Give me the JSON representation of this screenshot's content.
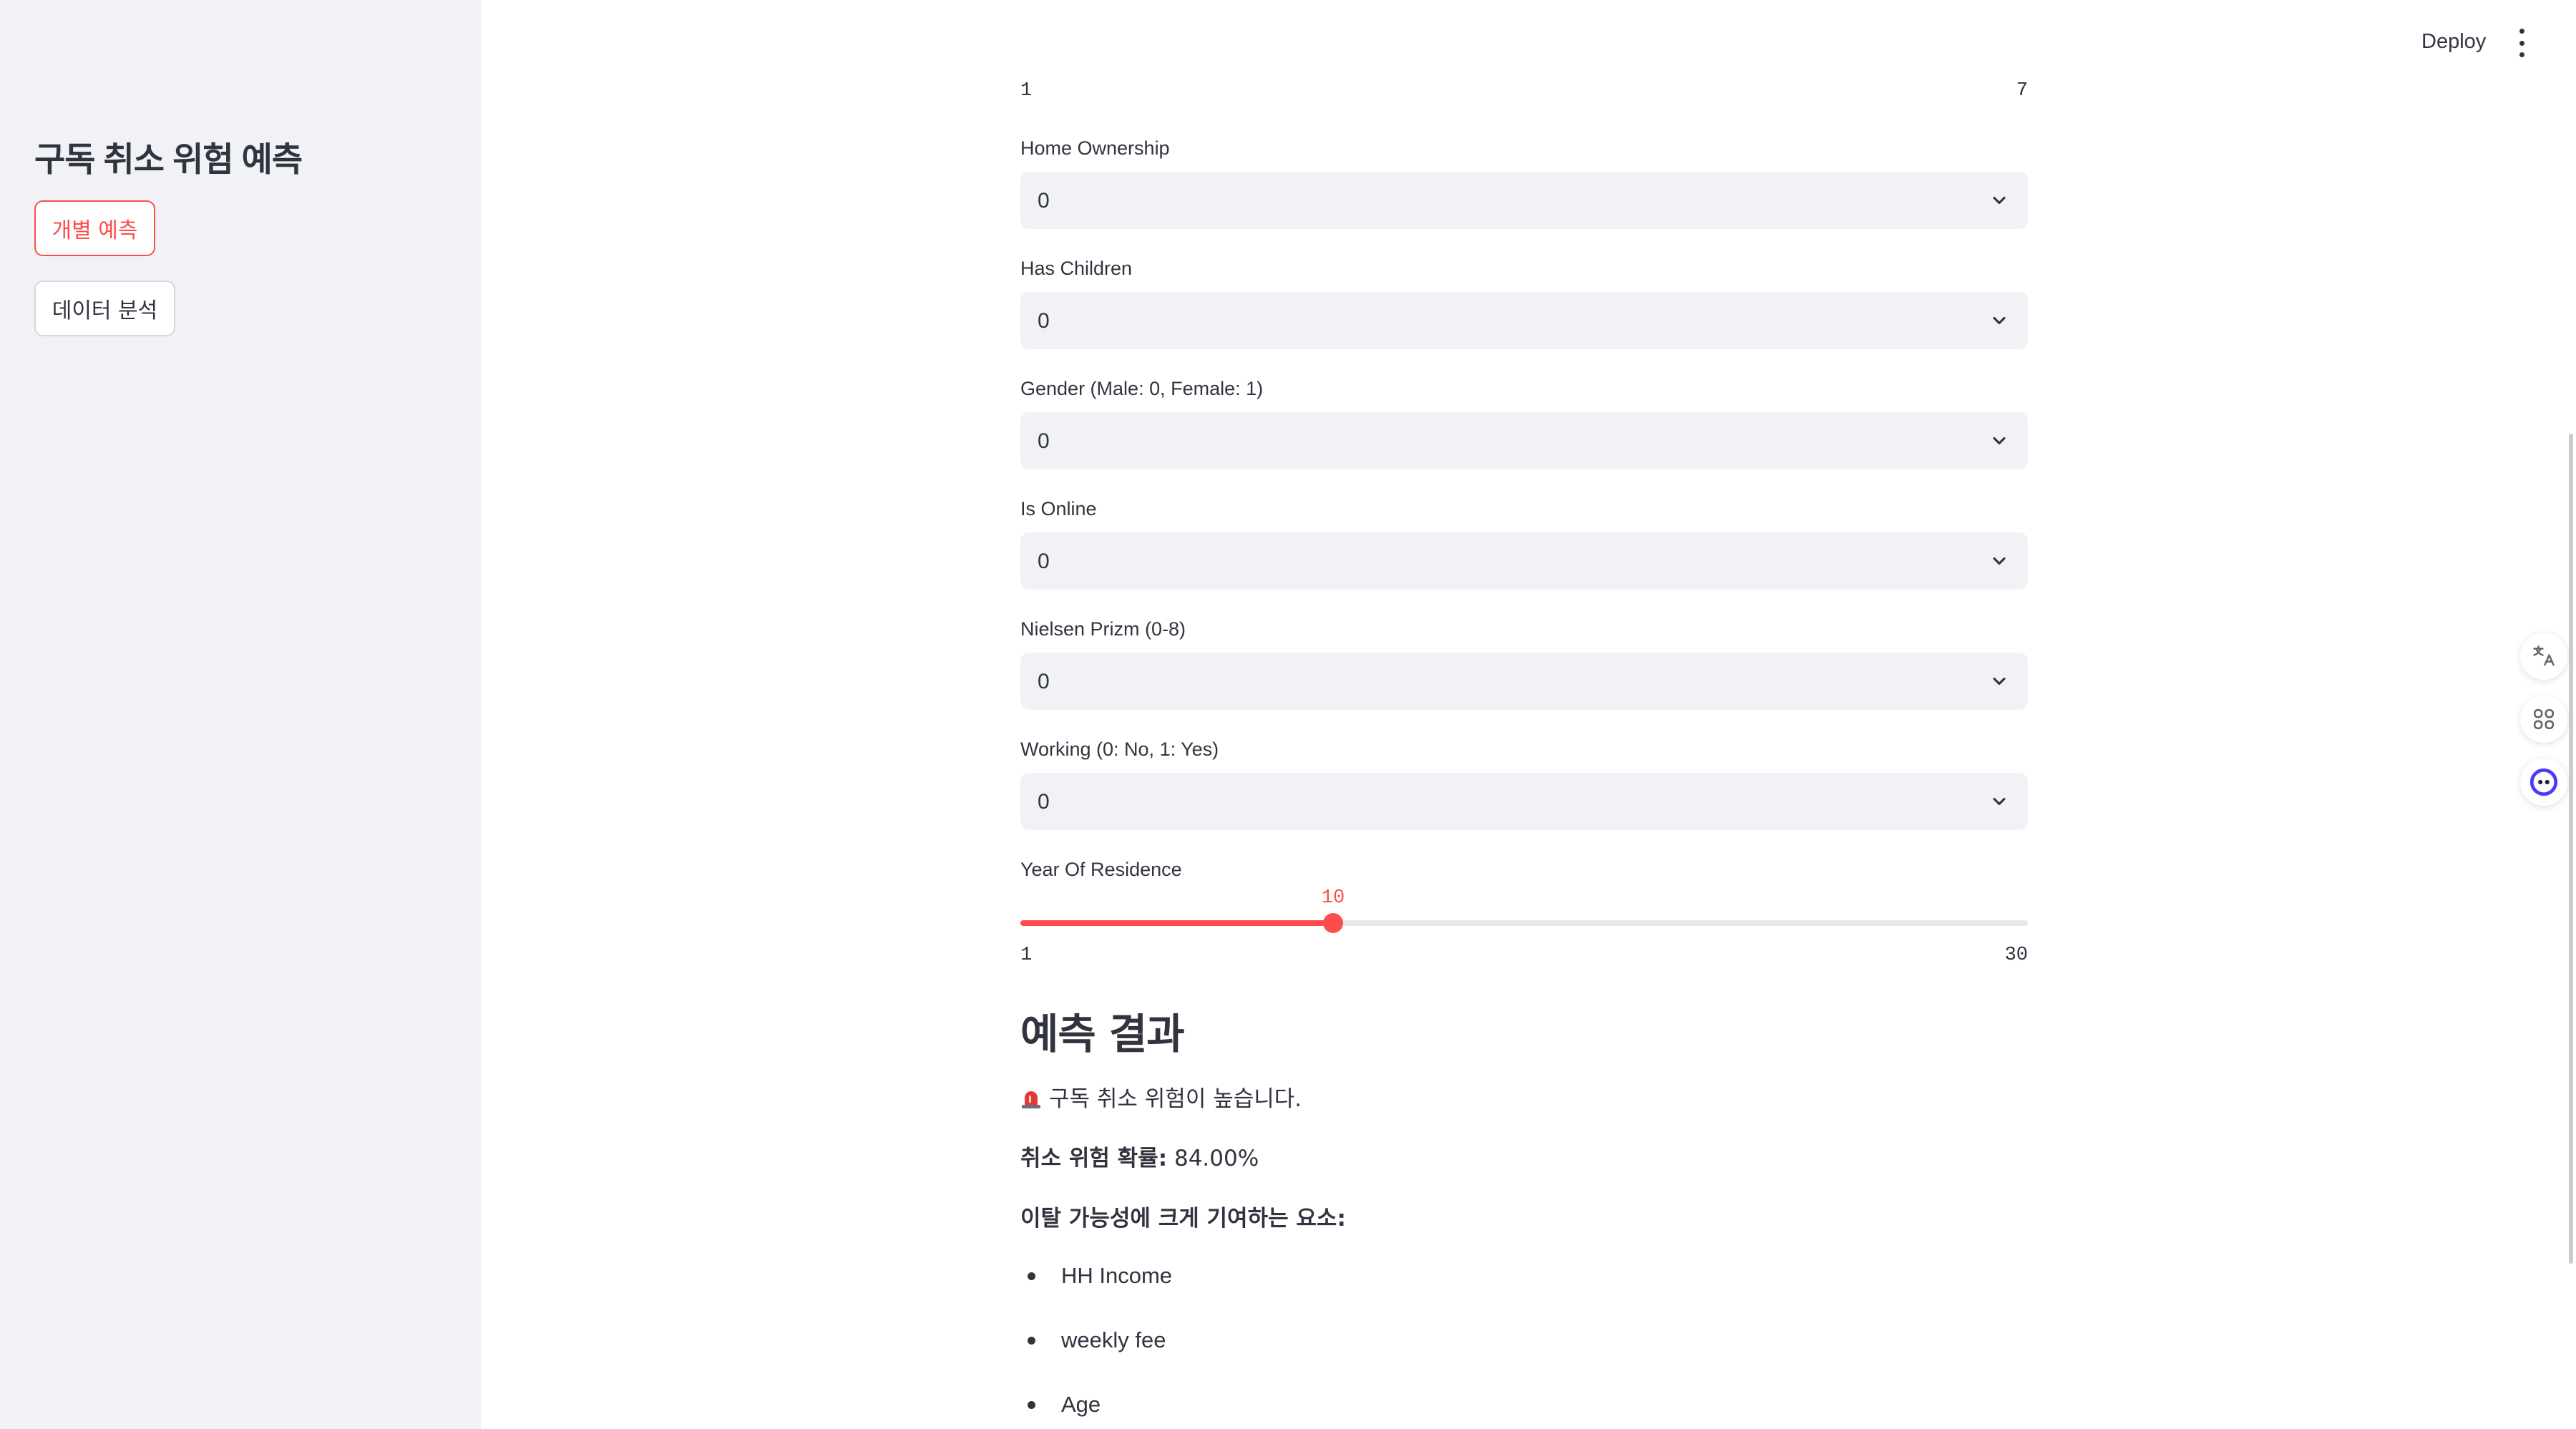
{
  "sidebar": {
    "title": "구독 취소 위험 예측",
    "nav": [
      {
        "label": "개별 예측",
        "active": true
      },
      {
        "label": "데이터 분석",
        "active": false
      }
    ]
  },
  "header": {
    "deploy_label": "Deploy",
    "menu_icon": "more-vertical-icon"
  },
  "top_slider": {
    "min_label": "1",
    "max_label": "7"
  },
  "fields": [
    {
      "label": "Home Ownership",
      "value": "0"
    },
    {
      "label": "Has Children",
      "value": "0"
    },
    {
      "label": "Gender (Male: 0, Female: 1)",
      "value": "0"
    },
    {
      "label": "Is Online",
      "value": "0"
    },
    {
      "label": "Nielsen Prizm (0-8)",
      "value": "0"
    },
    {
      "label": "Working (0: No, 1: Yes)",
      "value": "0"
    }
  ],
  "residence_slider": {
    "label": "Year Of Residence",
    "value": "10",
    "min": 1,
    "max": 30,
    "min_label": "1",
    "max_label": "30"
  },
  "result": {
    "heading": "예측 결과",
    "status_icon": "siren-icon",
    "status_text": "구독 취소 위험이 높습니다.",
    "probability_label": "취소 위험 확률:",
    "probability_value": "84.00%",
    "factors_title": "이탈 가능성에 크게 기여하는 요소:",
    "factors": [
      "HH Income",
      "weekly fee",
      "Age"
    ]
  },
  "floating_widgets": [
    "translate-icon",
    "apps-icon",
    "assistant-icon"
  ],
  "colors": {
    "accent": "#ff4b4b",
    "sidebar_bg": "#f0f2f6",
    "text": "#31333f"
  }
}
